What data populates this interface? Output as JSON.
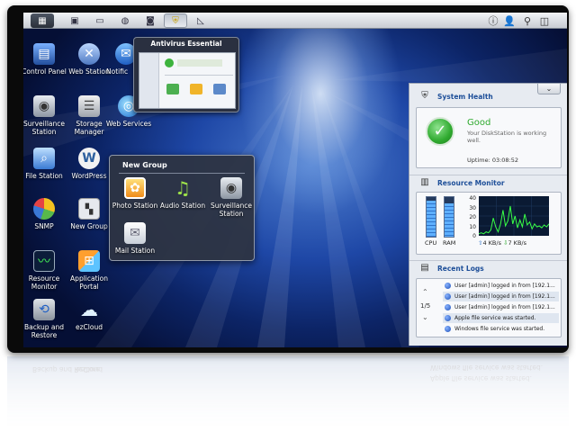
{
  "desktop": {
    "icons": [
      {
        "label": "Control Panel",
        "icon": "control-panel-icon"
      },
      {
        "label": "Web Station",
        "icon": "web-station-icon"
      },
      {
        "label": "Notific",
        "icon": "notification-icon"
      },
      {
        "label": "Surveillance Station",
        "icon": "surveillance-station-icon"
      },
      {
        "label": "Storage Manager",
        "icon": "storage-manager-icon"
      },
      {
        "label": "Web Services",
        "icon": "web-services-icon"
      },
      {
        "label": "File Station",
        "icon": "file-station-icon"
      },
      {
        "label": "WordPress",
        "icon": "wordpress-icon"
      },
      {
        "label": "SNMP",
        "icon": "snmp-icon"
      },
      {
        "label": "New Group",
        "icon": "new-group-icon"
      },
      {
        "label": "Resource Monitor",
        "icon": "resource-monitor-icon"
      },
      {
        "label": "Application Portal",
        "icon": "application-portal-icon"
      },
      {
        "label": "Backup and Restore",
        "icon": "backup-restore-icon"
      },
      {
        "label": "ezCloud",
        "icon": "ezcloud-icon"
      }
    ]
  },
  "tooltip": {
    "title": "Antivirus Essential"
  },
  "group": {
    "title": "New Group",
    "items": [
      {
        "label": "Photo Station"
      },
      {
        "label": "Audio Station"
      },
      {
        "label": "Surveillance Station"
      },
      {
        "label": "Mail Station"
      }
    ]
  },
  "health": {
    "title": "System Health",
    "status": "Good",
    "message": "Your DiskStation is working well.",
    "uptime": "Uptime: 03:08:52"
  },
  "monitor": {
    "title": "Resource Monitor",
    "cpu_label": "CPU",
    "ram_label": "RAM",
    "cpu_level": 0.9,
    "ram_level": 0.85,
    "axis": [
      "40",
      "30",
      "20",
      "10",
      "0"
    ],
    "up": "4 KB/s",
    "down": "7 KB/s",
    "series": [
      2,
      3,
      2,
      4,
      3,
      6,
      18,
      9,
      4,
      12,
      26,
      10,
      15,
      30,
      12,
      20,
      8,
      16,
      9,
      22,
      11,
      14,
      7,
      12,
      9,
      10,
      8,
      11,
      9,
      12
    ],
    "ymax": 40
  },
  "logs": {
    "title": "Recent Logs",
    "page": "1/5",
    "rows": [
      "User [admin] logged in from [192.1...",
      "User [admin] logged in from [192.1...",
      "User [admin] logged in from [192.1...",
      "Apple file service was started.",
      "Windows file service was started."
    ]
  },
  "colors": {
    "accent": "#1e4f99",
    "good": "#2faa2f",
    "chart_line": "#39ff46"
  }
}
